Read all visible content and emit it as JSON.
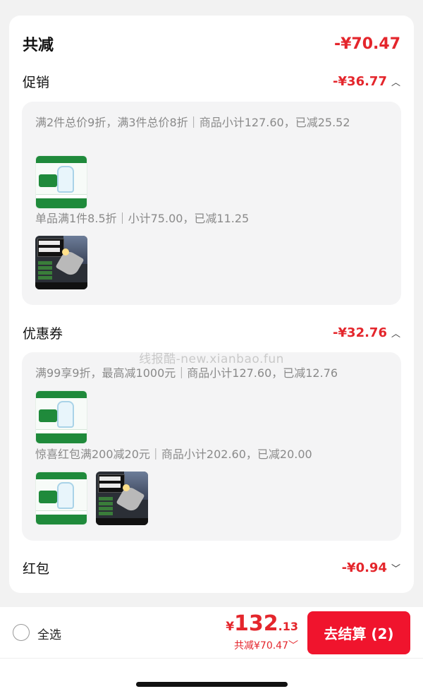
{
  "summary": {
    "label": "共减",
    "amount": "-¥70.47"
  },
  "promotion": {
    "label": "促销",
    "amount": "-¥36.77",
    "chevron": "︿",
    "rules": [
      {
        "text": "满2件总价9折，满3件总价8折｜商品小计127.60，已减25.52",
        "products": [
          "water-product-icon"
        ]
      },
      {
        "text": "单品满1件8.5折｜小计75.00，已减11.25",
        "products": [
          "tool-product-icon"
        ]
      }
    ]
  },
  "coupon": {
    "label": "优惠券",
    "amount": "-¥32.76",
    "chevron": "︿",
    "rules": [
      {
        "text": "满99享9折，最高减1000元｜商品小计127.60，已减12.76",
        "products": [
          "water-product-icon"
        ]
      },
      {
        "text": "惊喜红包满200减20元｜商品小计202.60，已减20.00",
        "products": [
          "water-product-icon",
          "tool-product-icon"
        ]
      }
    ]
  },
  "red_packet": {
    "label": "红包",
    "amount": "-¥0.94",
    "chevron": "﹀"
  },
  "watermark": "线报酷-new.xianbao.fun",
  "footer": {
    "select_all": "全选",
    "price_yen": "¥",
    "price_int": "132",
    "price_dec": ".13",
    "discount_text": "共减¥70.47",
    "discount_chevron": "﹀",
    "checkout_label": "去结算 (2)"
  },
  "colors": {
    "accent": "#e4262c",
    "button": "#f0142d"
  }
}
